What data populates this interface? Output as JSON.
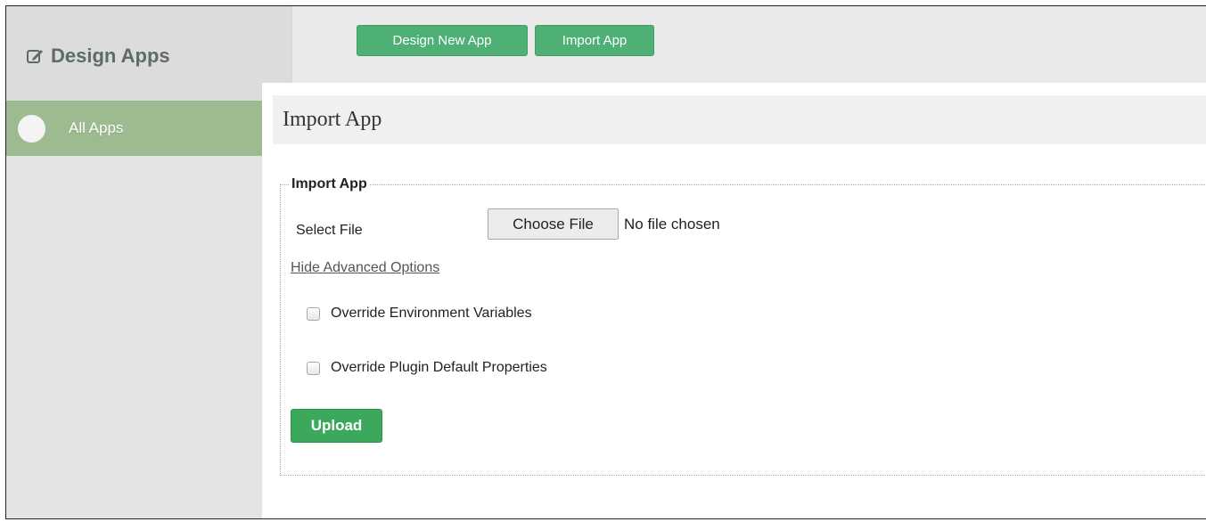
{
  "sidebar": {
    "title": "Design Apps",
    "title_icon": "edit-icon",
    "items": [
      {
        "label": "All Apps",
        "icon": "circle-icon",
        "active": true
      }
    ]
  },
  "toolbar": {
    "design_new_label": "Design New App",
    "import_label": "Import App"
  },
  "main": {
    "page_title": "Import App",
    "form": {
      "legend": "Import App",
      "select_file_label": "Select File",
      "choose_file_label": "Choose File",
      "file_status": "No file chosen",
      "advanced_toggle_label": "Hide Advanced Options",
      "options": [
        {
          "label": "Override Environment Variables",
          "checked": false
        },
        {
          "label": "Override Plugin Default Properties",
          "checked": false
        }
      ],
      "upload_label": "Upload"
    }
  },
  "colors": {
    "button_green": "#4fb076",
    "upload_green": "#3ca85c",
    "nav_active": "#9dba91",
    "sidebar_bg": "#e4e4e4"
  }
}
